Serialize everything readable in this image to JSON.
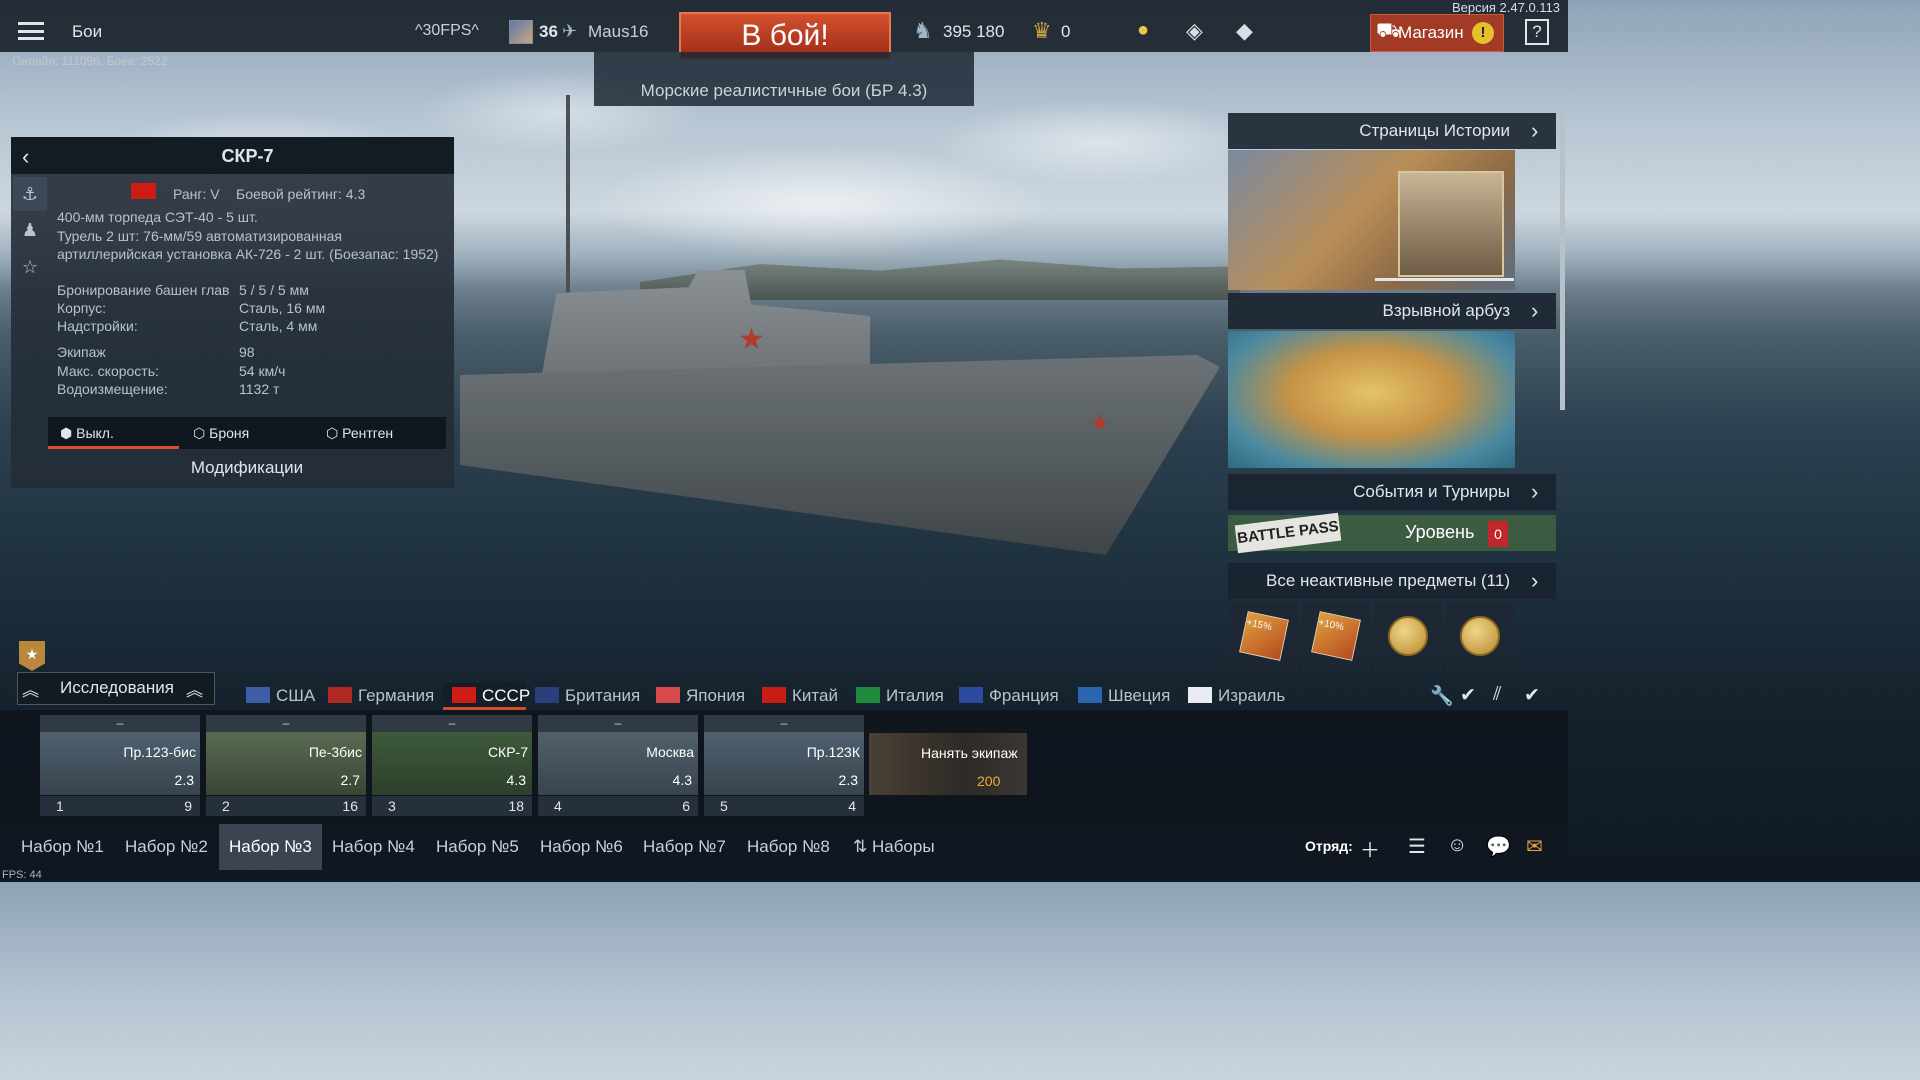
{
  "topbar": {
    "battles_label": "Бои",
    "fps_label": "^30FPS^",
    "player_level": "36",
    "player_name": "Maus16",
    "battle_button": "В бой!",
    "mode_label": "Морские реалистичные бои (БР 4.3)",
    "lions": "395 180",
    "eagles": "0",
    "store_label": "Магазин",
    "store_badge": "!",
    "help_label": "?",
    "version": "Версия 2.47.0.113",
    "online": "Онлайн: 111096, Боев: 2522"
  },
  "vehicle_panel": {
    "title": "СКР-7",
    "rank_label": "Ранг: V",
    "br_label": "Боевой рейтинг: 4.3",
    "weapons": [
      "400-мм торпеда СЭТ-40 - 5 шт.",
      "Турель 2 шт: 76-мм/59 автоматизированная",
      "артиллерийская установка АК-726 - 2 шт. (Боезапас: 1952)"
    ],
    "specs": [
      {
        "label": "Бронирование башен глав",
        "value": "5 / 5 / 5 мм"
      },
      {
        "label": "Корпус:",
        "value": "Сталь, 16 мм"
      },
      {
        "label": "Надстройки:",
        "value": "Сталь, 4 мм"
      },
      {
        "label": "Экипаж",
        "value": "98"
      },
      {
        "label": "Макс. скорость:",
        "value": "54 км/ч"
      },
      {
        "label": "Водоизмещение:",
        "value": "1132 т"
      }
    ],
    "view_tabs": [
      "Выкл.",
      "Броня",
      "Рентген"
    ],
    "mods_button": "Модификации"
  },
  "right_panel": {
    "history_title": "Страницы Истории",
    "watermelon_title": "Взрывной арбуз",
    "events_title": "События и Турниры",
    "battlepass_logo": "BATTLE PASS",
    "battlepass_label": "Уровень",
    "battlepass_level": "0",
    "inactive_title": "Все неактивные предметы (11)",
    "inactive_items": [
      "+15%",
      "+10%",
      "",
      ""
    ]
  },
  "research": {
    "label": "Исследования",
    "rank_badge": "★",
    "nations": [
      {
        "name": "США",
        "color": "#3c5ea8"
      },
      {
        "name": "Германия",
        "color": "#b02a24"
      },
      {
        "name": "СССР",
        "color": "#cc1c14"
      },
      {
        "name": "Британия",
        "color": "#2d3f7a"
      },
      {
        "name": "Япония",
        "color": "#d64a4a"
      },
      {
        "name": "Китай",
        "color": "#c81c14"
      },
      {
        "name": "Италия",
        "color": "#1f8a3c"
      },
      {
        "name": "Франция",
        "color": "#2c4aa0"
      },
      {
        "name": "Швеция",
        "color": "#2a65ad"
      },
      {
        "name": "Израиль",
        "color": "#e8ecf2"
      }
    ]
  },
  "slots": [
    {
      "top": "–",
      "name": "Пр.123-бис",
      "br": "2.3",
      "crew": "1",
      "count": "9"
    },
    {
      "top": "–",
      "name": "Пе-3бис",
      "br": "2.7",
      "crew": "2",
      "count": "16"
    },
    {
      "top": "–",
      "name": "СКР-7",
      "br": "4.3",
      "crew": "3",
      "count": "18"
    },
    {
      "top": "–",
      "name": "Москва",
      "br": "4.3",
      "crew": "4",
      "count": "6"
    },
    {
      "top": "–",
      "name": "Пр.123К",
      "br": "2.3",
      "crew": "5",
      "count": "4"
    }
  ],
  "hire": {
    "label": "Нанять экипаж",
    "cost": "200"
  },
  "presets": [
    "Набор №1",
    "Набор №2",
    "Набор №3",
    "Набор №4",
    "Набор №5",
    "Набор №6",
    "Набор №7",
    "Набор №8",
    "Наборы"
  ],
  "bottombar": {
    "squad_label": "Отряд:",
    "fps": "FPS: 44"
  },
  "colors": {
    "accent": "#d4522a",
    "battle_button": "#b8391f",
    "store": "#a23a26",
    "battlepass": "#3c5c42"
  }
}
